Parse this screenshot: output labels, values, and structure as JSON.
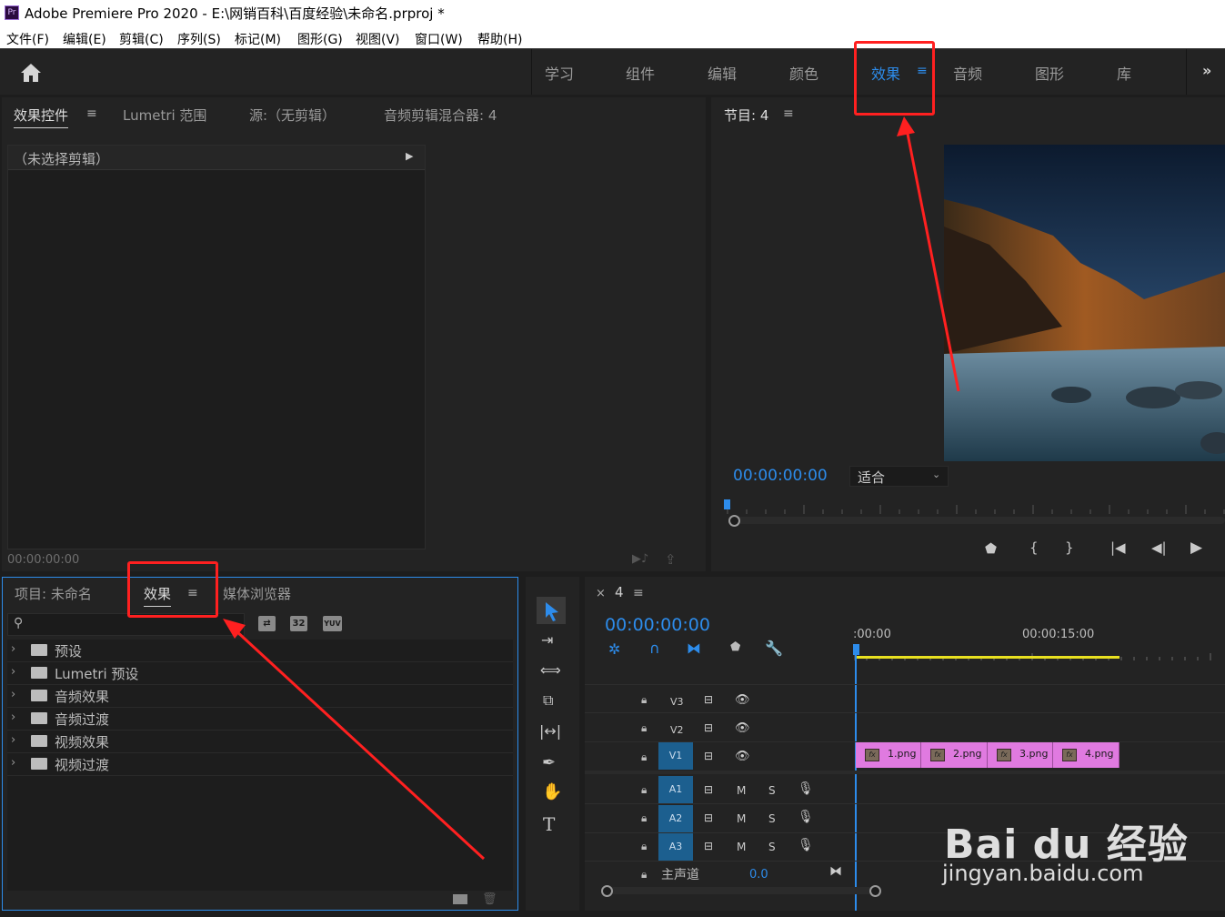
{
  "window": {
    "title": "Adobe Premiere Pro 2020 - E:\\网销百科\\百度经验\\未命名.prproj *",
    "app_icon": "Pr"
  },
  "menu": [
    "文件(F)",
    "编辑(E)",
    "剪辑(C)",
    "序列(S)",
    "标记(M)",
    "图形(G)",
    "视图(V)",
    "窗口(W)",
    "帮助(H)"
  ],
  "workspaces": {
    "items": [
      "学习",
      "组件",
      "编辑",
      "颜色",
      "效果",
      "音频",
      "图形",
      "库"
    ],
    "active": "效果",
    "more": "»"
  },
  "effect_controls_panel": {
    "tabs": [
      "效果控件",
      "Lumetri 范围",
      "源:（无剪辑）",
      "音频剪辑混合器: 4"
    ],
    "no_clip": "（未选择剪辑）",
    "timecode": "00:00:00:00"
  },
  "program_monitor": {
    "title": "节目: 4",
    "timecode": "00:00:00:00",
    "zoom": "适合"
  },
  "project_panel": {
    "tabs": [
      "项目: 未命名",
      "效果",
      "媒体浏览器"
    ],
    "search_placeholder": "",
    "filter_icons": [
      "32",
      "YUV"
    ],
    "tree": [
      {
        "label": "预设",
        "icon": "preset-folder-icon"
      },
      {
        "label": "Lumetri 预设",
        "icon": "preset-folder-icon"
      },
      {
        "label": "音频效果",
        "icon": "folder-icon"
      },
      {
        "label": "音频过渡",
        "icon": "folder-icon"
      },
      {
        "label": "视频效果",
        "icon": "folder-icon"
      },
      {
        "label": "视频过渡",
        "icon": "folder-icon"
      }
    ]
  },
  "timeline": {
    "sequence": "4",
    "close": "×",
    "timecode": "00:00:00:00",
    "ruler": [
      ":00:00",
      "00:00:15:00"
    ],
    "video_tracks": [
      "V3",
      "V2",
      "V1"
    ],
    "audio_tracks": [
      "A1",
      "A2",
      "A3"
    ],
    "track_mute": "M",
    "track_solo": "S",
    "master_label": "主声道",
    "master_value": "0.0",
    "clips": [
      "1.png",
      "2.png",
      "3.png",
      "4.png"
    ]
  },
  "watermark": {
    "brand": "Bai du 经验",
    "url": "jingyan.baidu.com"
  },
  "colors": {
    "accent_blue": "#2d8ceb",
    "clip_pink": "#e07ae0",
    "track_blue": "#1c5f8f",
    "highlight_red": "#ff2020"
  }
}
